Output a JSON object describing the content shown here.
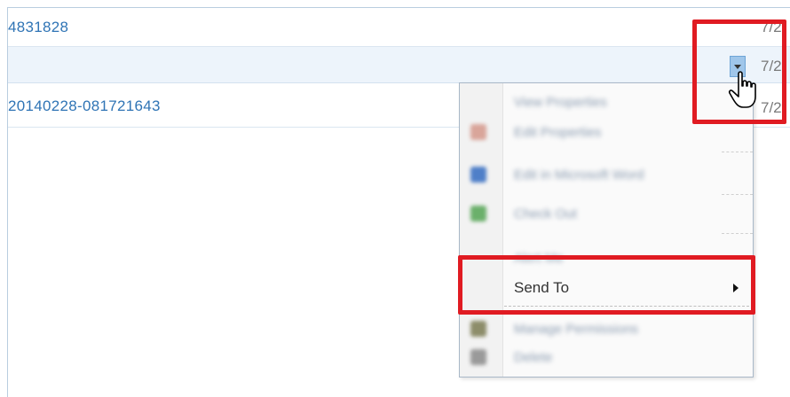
{
  "rows": [
    {
      "name": "4831828",
      "date": "7/2"
    },
    {
      "name": "",
      "date": "7/2"
    },
    {
      "name": "20140228-081721643",
      "date": "7/2"
    }
  ],
  "context_menu": {
    "items": [
      {
        "label": "View Properties",
        "icon": "view-properties-icon"
      },
      {
        "label": "Edit Properties",
        "icon": "edit-properties-icon"
      },
      {
        "label": "Edit in Microsoft Word",
        "icon": "word-icon"
      },
      {
        "label": "Check Out",
        "icon": "check-out-icon"
      },
      {
        "label": "Alert Me",
        "icon": ""
      },
      {
        "label": "Send To",
        "icon": "",
        "has_submenu": true
      },
      {
        "label": "Manage Permissions",
        "icon": "permissions-icon"
      },
      {
        "label": "Delete",
        "icon": "delete-icon"
      }
    ]
  },
  "colors": {
    "link": "#2f74b5",
    "highlight": "#e01b22",
    "selected_row": "#edf4fb"
  }
}
